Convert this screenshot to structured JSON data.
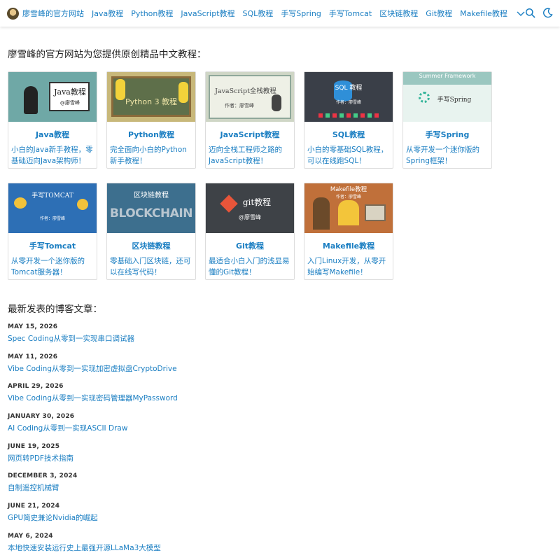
{
  "header": {
    "site_name": "廖雪峰的官方网站",
    "nav": [
      "Java教程",
      "Python教程",
      "JavaScript教程",
      "SQL教程",
      "手写Spring",
      "手写Tomcat",
      "区块链教程",
      "Git教程",
      "Makefile教程"
    ],
    "icons": [
      "logo-icon",
      "chevron-down-icon",
      "search-icon",
      "moon-icon"
    ]
  },
  "intro": "廖雪峰的官方网站为您提供原创精品中文教程：",
  "courses": [
    {
      "title": "Java教程",
      "desc": "小白的Java新手教程，零基础迈向Java架构师！",
      "thumb_text": "Java教程",
      "thumb_sub": "@廖雪峰",
      "bg": "#6fa8a6"
    },
    {
      "title": "Python教程",
      "desc": "完全面向小白的Python新手教程！",
      "thumb_text": "Python 3 教程",
      "thumb_sub": "",
      "bg": "#c8b87a"
    },
    {
      "title": "JavaScript教程",
      "desc": "迈向全栈工程师之路的JavaScript教程！",
      "thumb_text": "JavaScript全栈教程",
      "thumb_sub": "作者：廖雪峰",
      "bg": "#cfd6c6"
    },
    {
      "title": "SQL教程",
      "desc": "小白的零基础SQL教程，可以在线跑SQL！",
      "thumb_text": "SQL 教程",
      "thumb_sub": "作者：廖雪峰",
      "bg": "#3a3f48"
    },
    {
      "title": "手写Spring",
      "desc": "从零开发一个迷你版的Spring框架！",
      "thumb_text": "手写Spring",
      "thumb_sub": "Summer Framework",
      "bg": "#e8f3ef"
    },
    {
      "title": "手写Tomcat",
      "desc": "从零开发一个迷你版的Tomcat服务器！",
      "thumb_text": "手写TOMCAT",
      "thumb_sub": "作者：廖雪峰",
      "bg": "#2d6fb5"
    },
    {
      "title": "区块链教程",
      "desc": "零基础入门区块链，还可以在线写代码！",
      "thumb_text": "区块链教程",
      "thumb_sub": "BLOCKCHAIN",
      "bg": "#3d6f8e"
    },
    {
      "title": "Git教程",
      "desc": "最适合小白入门的浅显易懂的Git教程！",
      "thumb_text": "git教程",
      "thumb_sub": "@廖雪峰",
      "bg": "#3e4247"
    },
    {
      "title": "Makefile教程",
      "desc": "入门Linux开发，从零开始编写Makefile！",
      "thumb_text": "Makefile教程",
      "thumb_sub": "作者：廖雪峰",
      "bg": "#c0703a"
    }
  ],
  "blog_heading": "最新发表的博客文章：",
  "posts": [
    {
      "date": "MAY 15, 2026",
      "title": "Spec Coding从零到一实现串口调试器"
    },
    {
      "date": "MAY 11, 2026",
      "title": "Vibe Coding从零到一实现加密虚拟盘CryptoDrive"
    },
    {
      "date": "APRIL 29, 2026",
      "title": "Vibe Coding从零到一实现密码管理器MyPassword"
    },
    {
      "date": "JANUARY 30, 2026",
      "title": "AI Coding从零到一实现ASCII Draw"
    },
    {
      "date": "JUNE 19, 2025",
      "title": "网页转PDF技术指南"
    },
    {
      "date": "DECEMBER 3, 2024",
      "title": "自制遥控机械臂"
    },
    {
      "date": "JUNE 21, 2024",
      "title": "GPU简史兼论Nvidia的崛起"
    },
    {
      "date": "MAY 6, 2024",
      "title": "本地快速安装运行史上最强开源LLaMa3大模型"
    }
  ]
}
